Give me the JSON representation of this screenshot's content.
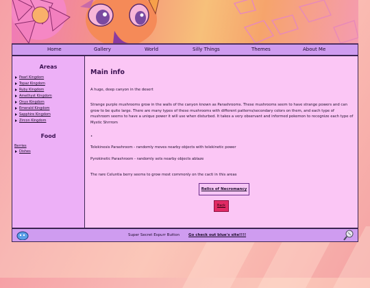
{
  "nav": {
    "items": [
      "Home",
      "Gallery",
      "World",
      "Silly Things",
      "Themes",
      "About Me"
    ]
  },
  "sidebar": {
    "areas_heading": "Areas",
    "areas": [
      "Pearl Kingdom",
      "Topaz Kingdom",
      "Ruby Kingdom",
      "Amethyst Kingdom",
      "Onyx Kingdom",
      "Emerald Kingdom",
      "Sapphire Kingdom",
      "Zircon Kingdom"
    ],
    "food_heading": "Food",
    "food_group": "Berries",
    "food_items": [
      "Dishes"
    ]
  },
  "main": {
    "title": "Main info",
    "intro": "A huge, deep canyon in the desert",
    "paragraph": "Strange purple mushrooms grow in the walls of the canyon known as Parashrooms. These mushrooms seem to have strange powers and can grow to be quite large. There are many types of these mushrooms with different patterns/secondary colors on them, and each type of mushroom seems to have a unique power it will use when disturbed. It takes a very observant and informed pokemon to recognize each type of Mystic Shrrrom",
    "bullet": "•",
    "telekinesis": "Telekinesis Parashroom - randomly moves nearby objects with telekinetic power",
    "pyrokinetic": "Pyrokinetic Parashroom - randomly sets nearby objects ablaze",
    "berry_note": "The rare Celuntia berry seems to grow most commonly on the cacti in this areas",
    "relics_label": "Relics of Necromancy",
    "back_label": "Back"
  },
  "footer": {
    "text": "Super Secret Espurr Button",
    "link": "Go check out blue's site!!!!"
  },
  "colors": {
    "nav_bg": "#cf9cf0",
    "sidebar_bg": "#edb0f7",
    "content_bg": "#fbc6f5",
    "back_button": "#e02a64"
  },
  "icons": {
    "footer_left": "blue-blob-icon",
    "footer_right": "magnifier-pokemon-icon"
  }
}
